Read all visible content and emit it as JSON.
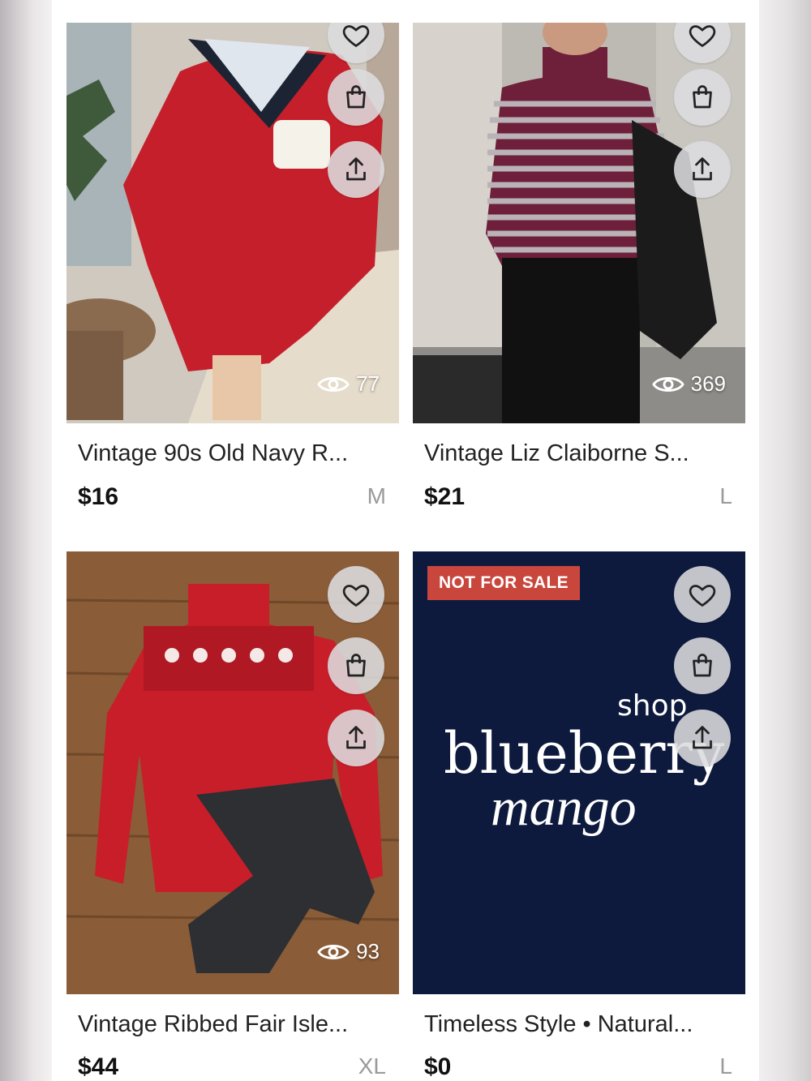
{
  "listings": [
    {
      "title": "Vintage 90s Old Navy R...",
      "price": "$16",
      "size": "M",
      "views": "77",
      "badge": ""
    },
    {
      "title": "Vintage Liz Claiborne S...",
      "price": "$21",
      "size": "L",
      "views": "369",
      "badge": ""
    },
    {
      "title": "Vintage Ribbed Fair Isle...",
      "price": "$44",
      "size": "XL",
      "views": "93",
      "badge": ""
    },
    {
      "title": "Timeless Style • Natural...",
      "price": "$0",
      "size": "L",
      "views": "",
      "badge": "NOT FOR SALE",
      "logo": {
        "line1": "shop",
        "line2": "blueberry",
        "line3": "mango"
      }
    }
  ],
  "icons": {
    "like": "heart-icon",
    "bag": "shopping-bag-icon",
    "share": "share-icon",
    "views": "eye-icon"
  },
  "colors": {
    "badge": "#c9463d",
    "price": "#111111",
    "size": "#9a9a9a"
  }
}
